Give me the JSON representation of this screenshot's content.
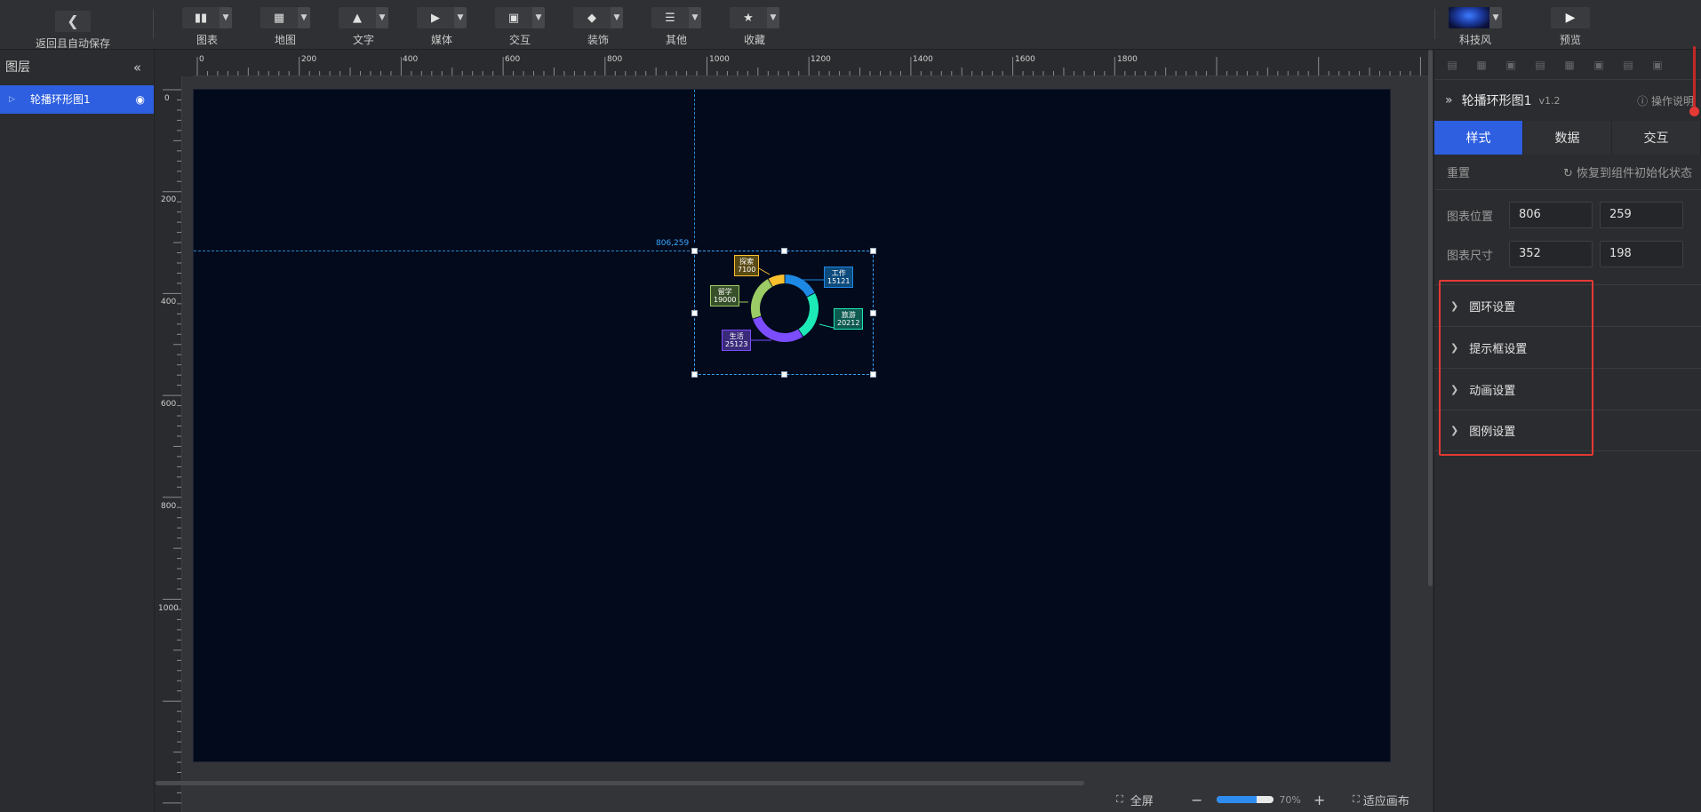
{
  "toolbar": {
    "back_label": "返回且自动保存",
    "tools": [
      {
        "label": "图表",
        "icon": "chart-icon"
      },
      {
        "label": "地图",
        "icon": "map-icon"
      },
      {
        "label": "文字",
        "icon": "text-icon"
      },
      {
        "label": "媒体",
        "icon": "media-icon"
      },
      {
        "label": "交互",
        "icon": "interaction-icon"
      },
      {
        "label": "装饰",
        "icon": "decoration-icon"
      },
      {
        "label": "其他",
        "icon": "other-icon"
      },
      {
        "label": "收藏",
        "icon": "favorite-icon"
      }
    ],
    "theme_label": "科技风",
    "preview_label": "预览"
  },
  "layers": {
    "title": "图层",
    "items": [
      {
        "label": "轮播环形图1"
      }
    ]
  },
  "rulers": {
    "horizontal": [
      "0",
      "200",
      "400",
      "600",
      "800",
      "1000",
      "1200",
      "1400",
      "1600",
      "1800"
    ],
    "vertical": [
      "0",
      "200",
      "400",
      "600",
      "800",
      "1000"
    ]
  },
  "canvas": {
    "coord_tip": "806,259",
    "donut": {
      "segments": [
        {
          "name": "工作",
          "value": "15121",
          "color": "#1e88e5"
        },
        {
          "name": "旅游",
          "value": "20212",
          "color": "#1de9b6"
        },
        {
          "name": "生活",
          "value": "25123",
          "color": "#7c4dff"
        },
        {
          "name": "留学",
          "value": "19000",
          "color": "#9ccc65"
        },
        {
          "name": "探索",
          "value": "7100",
          "color": "#fbc02d"
        }
      ]
    }
  },
  "bottom": {
    "fullscreen": "全屏",
    "zoom_value": "70%",
    "zoom_fraction": 0.7,
    "fit": "适应画布"
  },
  "props": {
    "component_name": "轮播环形图1",
    "version": "v1.2",
    "help": "操作说明",
    "tabs": [
      "样式",
      "数据",
      "交互"
    ],
    "reset_label": "重置",
    "restore_label": "恢复到组件初始化状态",
    "position_label": "图表位置",
    "position": [
      "806",
      "259"
    ],
    "size_label": "图表尺寸",
    "size": [
      "352",
      "198"
    ],
    "sections": [
      "圆环设置",
      "提示框设置",
      "动画设置",
      "图例设置"
    ]
  }
}
